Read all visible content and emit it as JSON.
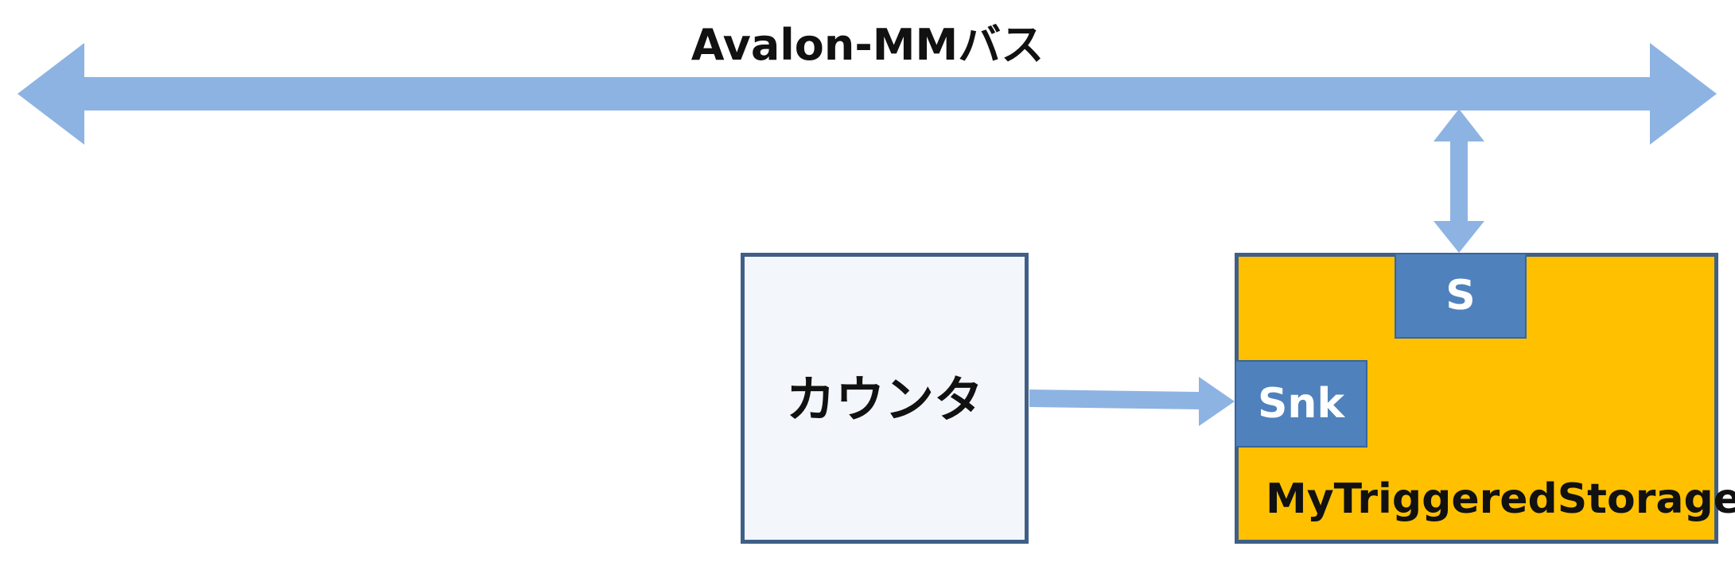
{
  "bus": {
    "label": "Avalon-MMバス",
    "color": "#8db3e2"
  },
  "counter": {
    "label": "カウンタ",
    "fill": "#f3f6fb",
    "border": "#3f5f86"
  },
  "storage": {
    "label": "MyTriggeredStorage",
    "fill": "#ffc000",
    "border": "#3f5f86",
    "ports": {
      "slave_label": "S",
      "sink_label": "Snk",
      "port_color": "#4f81bd"
    }
  }
}
